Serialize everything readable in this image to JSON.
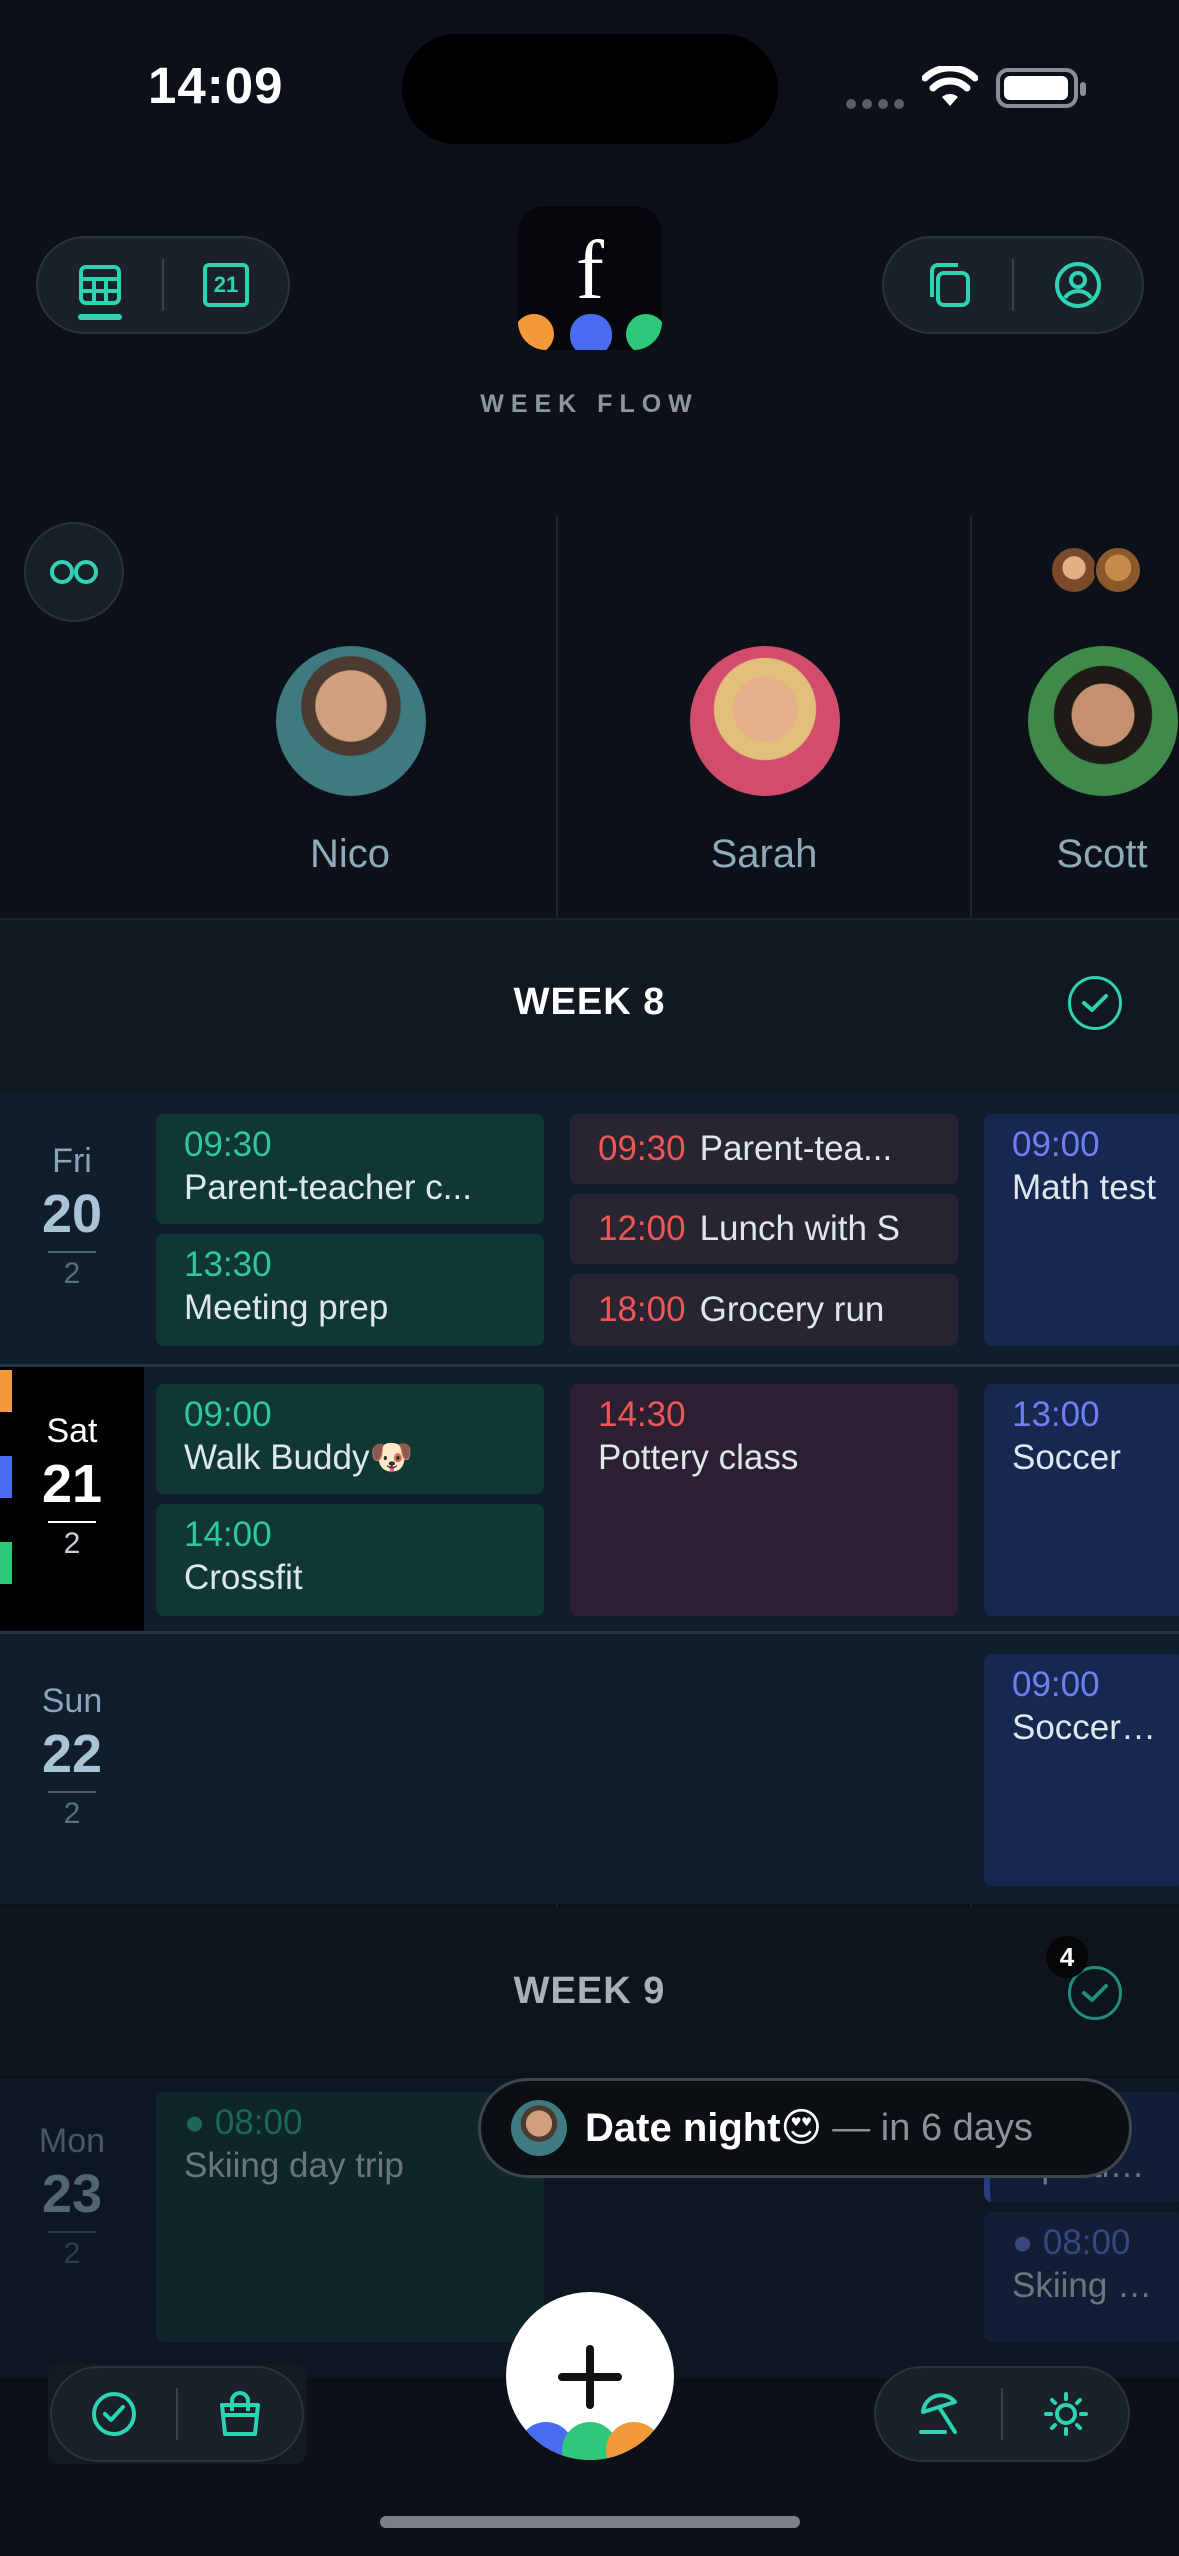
{
  "status_bar": {
    "time": "14:09"
  },
  "app": {
    "name": "WEEK FLOW",
    "logo_letter": "f"
  },
  "top_left_nav": {
    "calendar_badge": "21"
  },
  "people": [
    {
      "name": "Nico"
    },
    {
      "name": "Sarah"
    },
    {
      "name": "Scott"
    }
  ],
  "weeks": [
    {
      "title": "WEEK 8",
      "days": [
        {
          "dow": "Fri",
          "date": "20",
          "week_num": "2",
          "nico": [
            {
              "time": "09:30",
              "title": "Parent-teacher c..."
            },
            {
              "time": "13:30",
              "title": "Meeting prep"
            }
          ],
          "sarah": [
            {
              "time": "09:30",
              "title": "Parent-tea..."
            },
            {
              "time": "12:00",
              "title": "Lunch with S"
            },
            {
              "time": "18:00",
              "title": "Grocery run"
            }
          ],
          "scott": [
            {
              "time": "09:00",
              "title": "Math test"
            }
          ]
        },
        {
          "dow": "Sat",
          "date": "21",
          "week_num": "2",
          "nico": [
            {
              "time": "09:00",
              "title": "Walk Buddy🐶"
            },
            {
              "time": "14:00",
              "title": "Crossfit"
            }
          ],
          "sarah": [
            {
              "time": "14:30",
              "title": "Pottery class"
            }
          ],
          "scott": [
            {
              "time": "13:00",
              "title": "Soccer"
            }
          ]
        },
        {
          "dow": "Sun",
          "date": "22",
          "week_num": "2",
          "scott": [
            {
              "time": "09:00",
              "title": "Soccer ga"
            }
          ]
        }
      ]
    },
    {
      "title": "WEEK 9",
      "badge": "4",
      "days": [
        {
          "dow": "Mon",
          "date": "23",
          "week_num": "2",
          "nico": [
            {
              "time": "08:00",
              "title": "Skiing day trip"
            }
          ],
          "scott": [
            {
              "time": "AY",
              "title": "Sportlov s"
            },
            {
              "time": "08:00",
              "title": "Skiing day"
            }
          ]
        }
      ]
    }
  ],
  "toast": {
    "title": "Date night😍",
    "subtitle": "— in 6 days"
  },
  "colors": {
    "accent": "#2dd4b4",
    "nico": "#2fc79f",
    "sarah": "#f05654",
    "scott": "#6f7ff3"
  },
  "icons": [
    "grid-icon",
    "calendar-icon",
    "copy-icon",
    "profile-icon",
    "link-icon",
    "check-icon",
    "bag-icon",
    "umbrella-icon",
    "sun-icon",
    "plus-icon"
  ]
}
